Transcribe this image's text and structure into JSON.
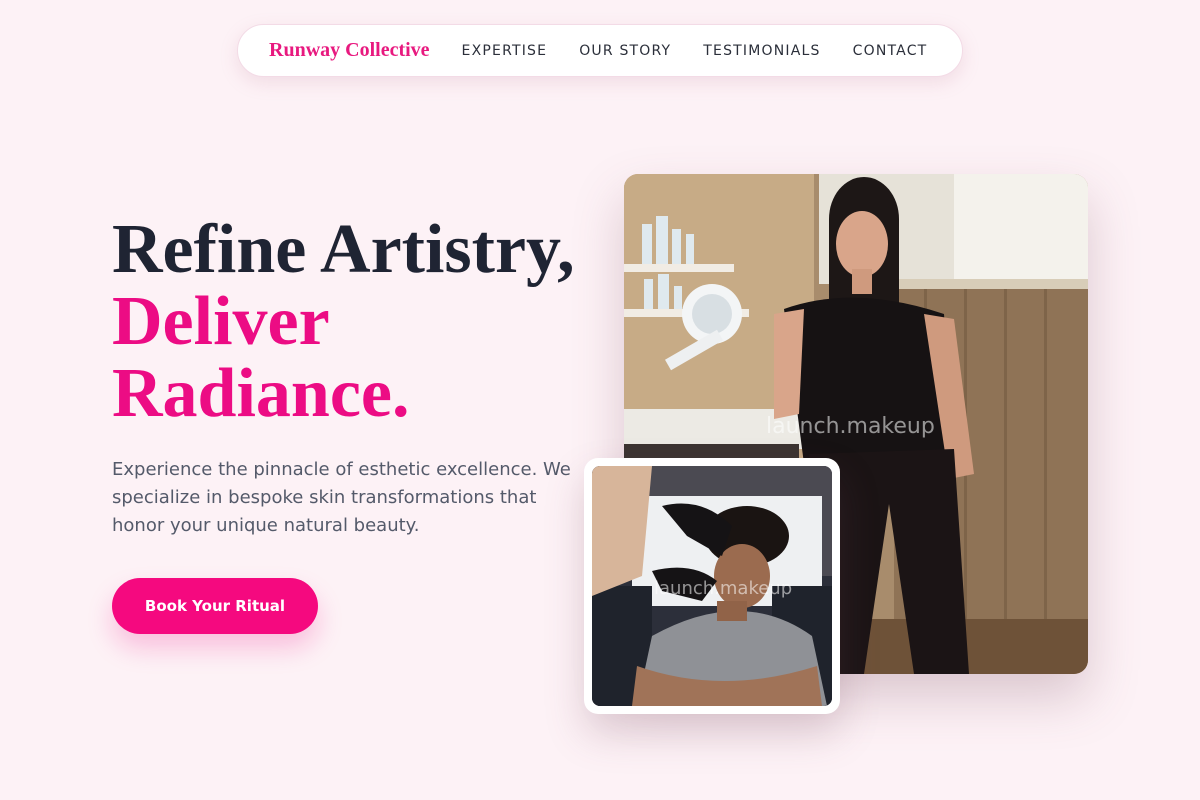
{
  "nav": {
    "brand": "Runway Collective",
    "links": [
      "EXPERTISE",
      "OUR STORY",
      "TESTIMONIALS",
      "CONTACT"
    ]
  },
  "hero": {
    "headline_line1": "Refine Artistry,",
    "headline_line2": "Deliver",
    "headline_line3": "Radiance.",
    "subtext": "Experience the pinnacle of esthetic excellence. We specialize in bespoke skin transformations that honor your unique natural beauty.",
    "cta_label": "Book Your Ritual"
  },
  "images": {
    "main_watermark": "launch.makeup",
    "inset_watermark": "launch.makeup"
  },
  "colors": {
    "background": "#fdf2f6",
    "accent": "#ec0c84",
    "heading": "#1f2433",
    "body_text": "#545a6a"
  }
}
